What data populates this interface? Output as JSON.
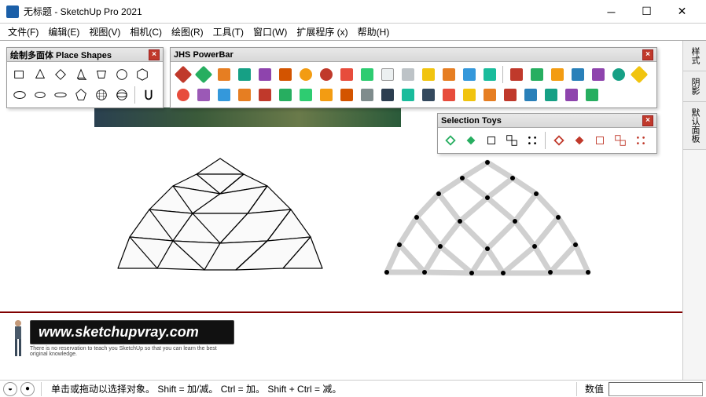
{
  "window": {
    "title": "无标题 - SketchUp Pro 2021"
  },
  "menu": [
    "文件(F)",
    "编辑(E)",
    "视图(V)",
    "相机(C)",
    "绘图(R)",
    "工具(T)",
    "窗口(W)",
    "扩展程序 (x)",
    "帮助(H)"
  ],
  "toolbars": {
    "place_shapes": {
      "title": "绘制多面体 Place Shapes"
    },
    "jhs_powerbar": {
      "title": "JHS PowerBar"
    },
    "selection_toys": {
      "title": "Selection Toys"
    }
  },
  "sidebar": {
    "tabs": [
      "样式",
      "阴影",
      "默认面板"
    ]
  },
  "status": {
    "message": "单击或拖动以选择对象。 Shift = 加/减。 Ctrl = 加。 Shift + Ctrl = 减。",
    "value_label": "数值"
  },
  "watermark": {
    "url": "www.sketchupvray.com",
    "caption": "There is no reservation to teach you SketchUp so that you can learn the best original knowledge."
  }
}
